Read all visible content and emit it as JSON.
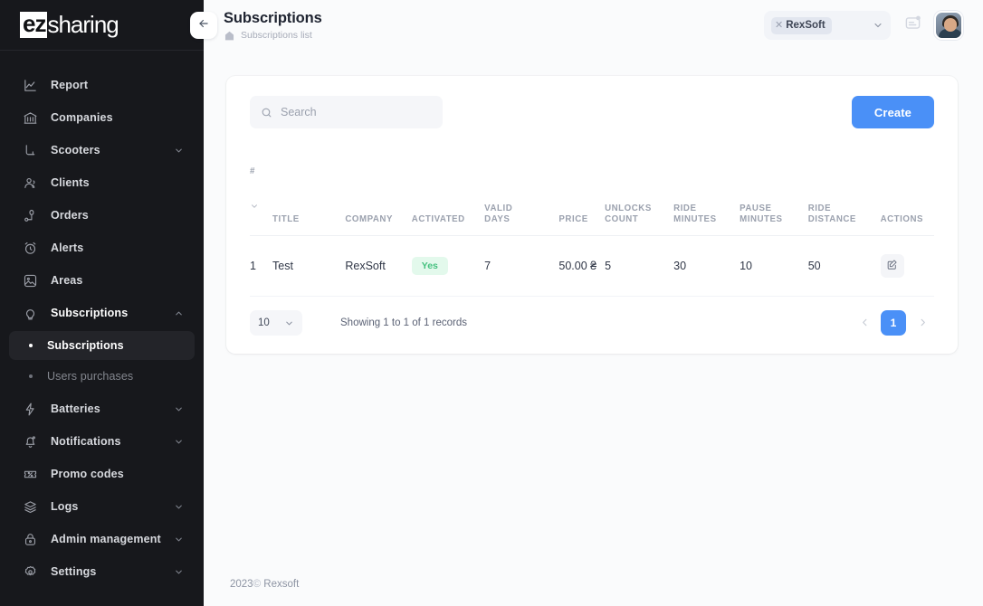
{
  "sidebar": {
    "logo": {
      "mark": "ez",
      "word": "sharing"
    },
    "collapse_icon": "arrow-left-icon",
    "items": [
      {
        "label": "Report",
        "icon": "chart-line-icon",
        "expandable": false
      },
      {
        "label": "Companies",
        "icon": "bank-icon",
        "expandable": false
      },
      {
        "label": "Scooters",
        "icon": "scooter-icon",
        "expandable": true
      },
      {
        "label": "Clients",
        "icon": "users-icon",
        "expandable": false
      },
      {
        "label": "Orders",
        "icon": "map-pin-icon",
        "expandable": false
      },
      {
        "label": "Alerts",
        "icon": "alarm-clock-icon",
        "expandable": false
      },
      {
        "label": "Areas",
        "icon": "image-area-icon",
        "expandable": false
      },
      {
        "label": "Subscriptions",
        "icon": "lightbulb-icon",
        "expandable": true,
        "expanded": true
      },
      {
        "label": "Batteries",
        "icon": "bolt-icon",
        "expandable": true
      },
      {
        "label": "Notifications",
        "icon": "bell-icon",
        "expandable": true
      },
      {
        "label": "Promo codes",
        "icon": "ticket-percent-icon",
        "expandable": false
      },
      {
        "label": "Logs",
        "icon": "layers-icon",
        "expandable": true
      },
      {
        "label": "Admin management",
        "icon": "lock-icon",
        "expandable": true
      },
      {
        "label": "Settings",
        "icon": "gear-icon",
        "expandable": true
      }
    ],
    "subitems": [
      {
        "label": "Subscriptions",
        "selected": true
      },
      {
        "label": "Users purchases",
        "selected": false
      }
    ]
  },
  "header": {
    "title": "Subscriptions",
    "breadcrumb": "Subscriptions list",
    "breadcrumb_icon": "home-icon",
    "company_chip": "RexSoft",
    "chip_remove_icon": "close-icon",
    "select_chevron_icon": "chevron-down-icon",
    "notification_icon": "message-icon",
    "avatar": "user-avatar"
  },
  "toolbar": {
    "search_placeholder": "Search",
    "search_value": "",
    "search_icon": "search-icon",
    "create_label": "Create"
  },
  "table": {
    "columns": [
      "#",
      "TITLE",
      "COMPANY",
      "ACTIVATED",
      "VALID\nDAYS",
      "PRICE",
      "UNLOCKS\nCOUNT",
      "RIDE\nMINUTES",
      "PAUSE\nMINUTES",
      "RIDE\nDISTANCE",
      "ACTIONS"
    ],
    "sort_icon": "chevron-down-icon",
    "rows": [
      {
        "num": "1",
        "title": "Test",
        "company": "RexSoft",
        "activated": "Yes",
        "valid_days": "7",
        "price": "50.00 ₴",
        "unlocks_count": "5",
        "ride_minutes": "30",
        "pause_minutes": "10",
        "ride_distance": "50",
        "action_icon": "edit-icon"
      }
    ]
  },
  "pagination": {
    "page_size": "10",
    "page_size_chevron": "chevron-down-icon",
    "records_text": "Showing 1 to 1 of 1 records",
    "prev_icon": "chevron-left-icon",
    "next_icon": "chevron-right-icon",
    "current_page": "1"
  },
  "footer": {
    "year": "2023",
    "copyright_mark": "©",
    "company": "Rexsoft"
  },
  "colors": {
    "accent": "#4a90f7",
    "sidebar_bg": "#17181c",
    "page_bg": "#fafbfc",
    "badge_green_text": "#45c17f",
    "badge_green_bg": "#e3f9ec"
  }
}
